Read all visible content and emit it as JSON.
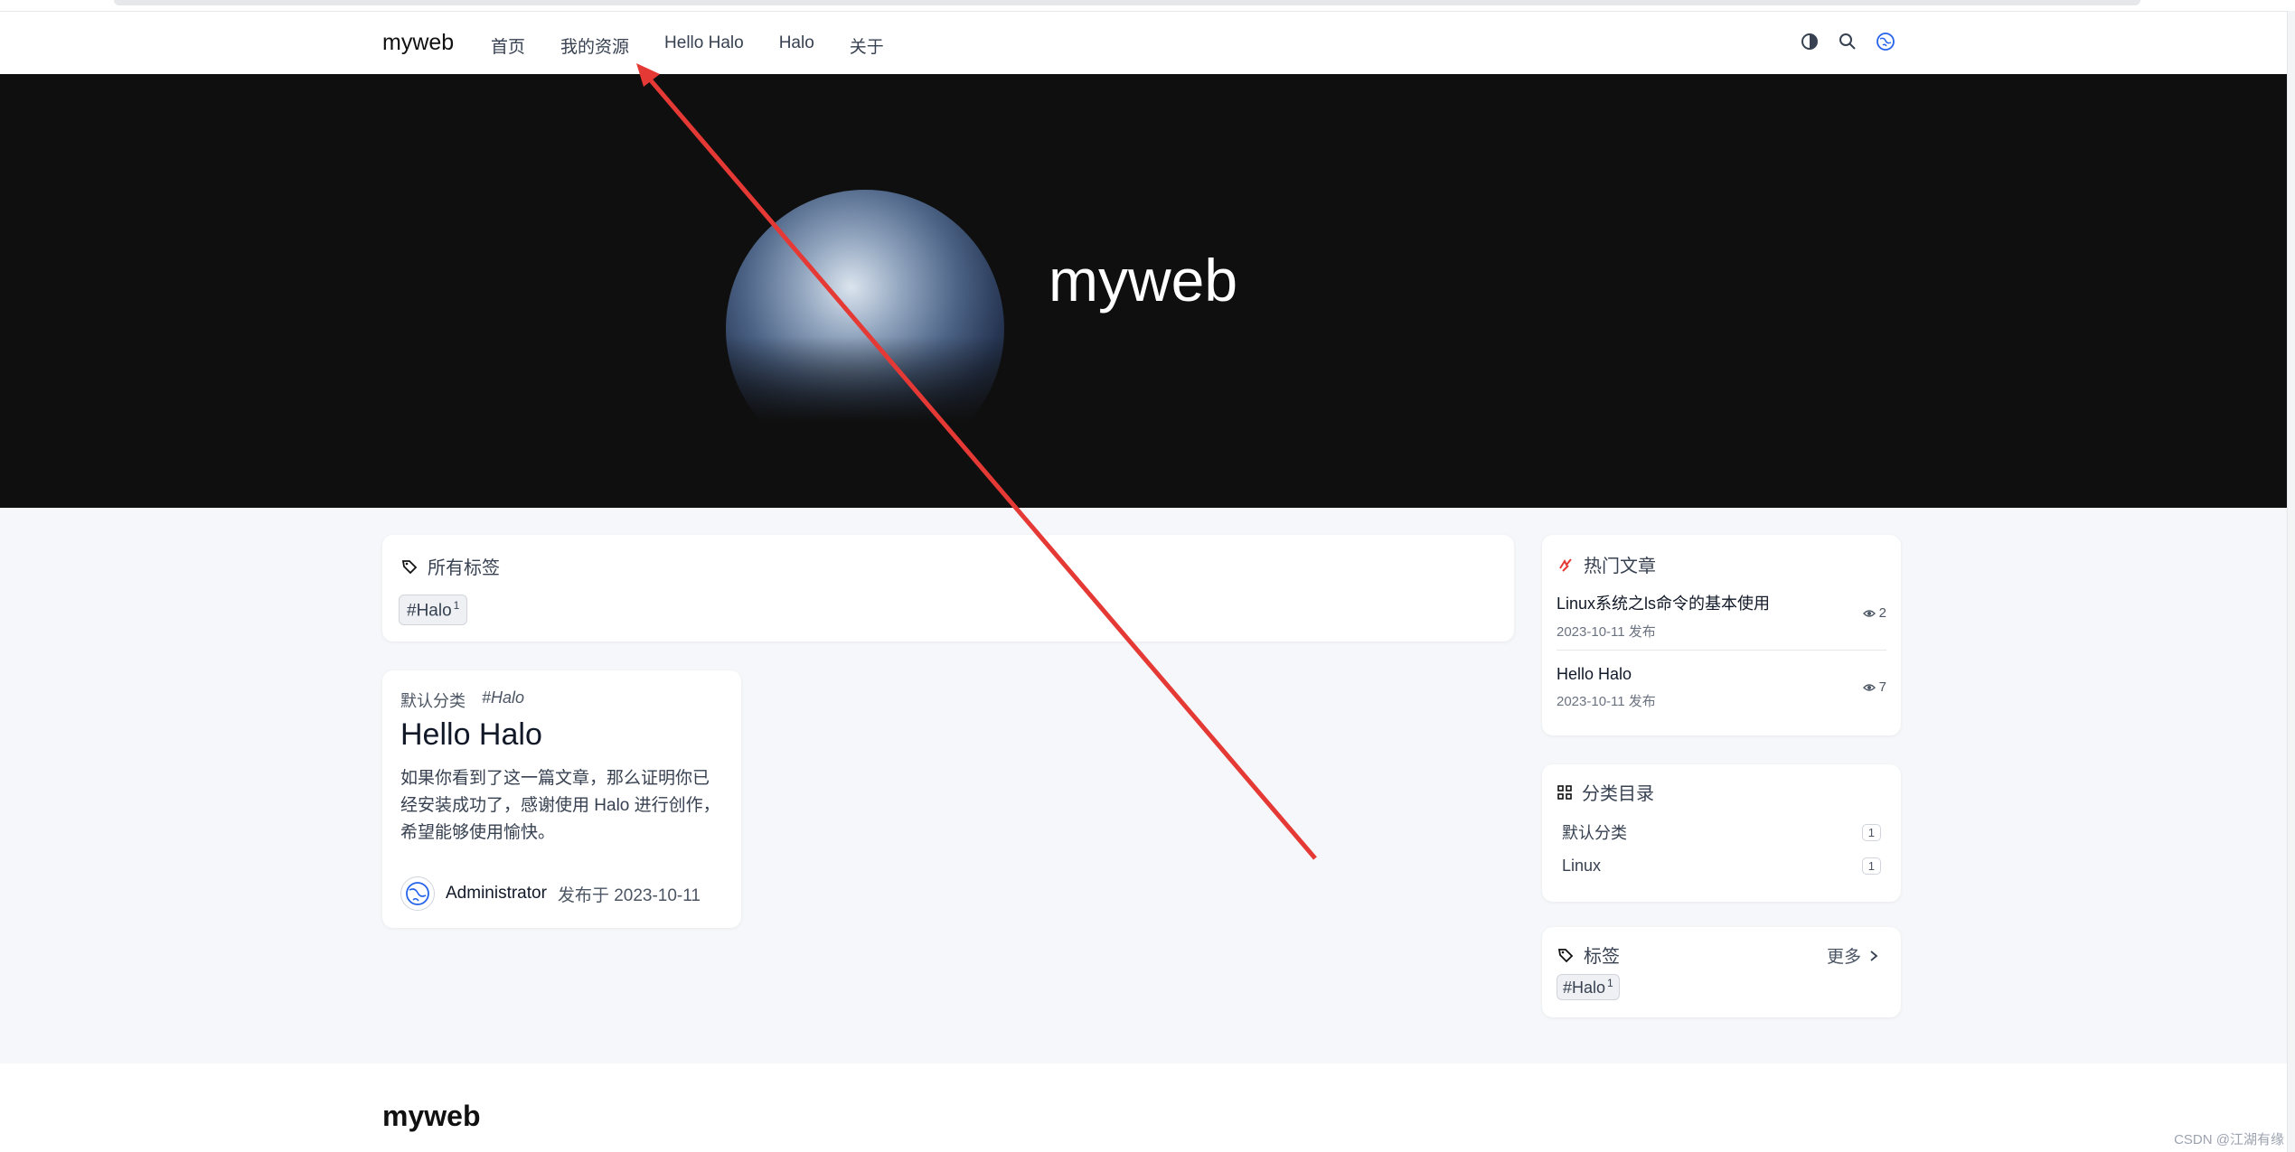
{
  "nav": {
    "brand": "myweb",
    "links": [
      "首页",
      "我的资源",
      "Hello Halo",
      "Halo",
      "关于"
    ],
    "icons": [
      "theme-toggle-icon",
      "search-icon",
      "globe-icon"
    ]
  },
  "hero": {
    "title": "myweb"
  },
  "all_tags": {
    "heading": "所有标签",
    "tag": {
      "label": "#Halo",
      "count": "1"
    }
  },
  "post": {
    "category": "默认分类",
    "tag": "#Halo",
    "title": "Hello Halo",
    "excerpt": "如果你看到了这一篇文章，那么证明你已经安装成功了，感谢使用 Halo 进行创作，希望能够使用愉快。",
    "author": "Administrator",
    "date": "发布于 2023-10-11"
  },
  "hot": {
    "heading": "热门文章",
    "items": [
      {
        "title": "Linux系统之ls命令的基本使用",
        "date": "2023-10-11 发布",
        "views": "2"
      },
      {
        "title": "Hello Halo",
        "date": "2023-10-11 发布",
        "views": "7"
      }
    ]
  },
  "categories": {
    "heading": "分类目录",
    "items": [
      {
        "name": "默认分类",
        "count": "1"
      },
      {
        "name": "Linux",
        "count": "1"
      }
    ]
  },
  "tags": {
    "heading": "标签",
    "more": "更多",
    "tag": {
      "label": "#Halo",
      "count": "1"
    }
  },
  "footer": {
    "brand": "myweb"
  },
  "watermark": "CSDN @江湖有缘",
  "colors": {
    "hero_bg": "#0f0f0f",
    "content_bg": "#f5f7fa",
    "annotation_arrow": "#e53935"
  }
}
